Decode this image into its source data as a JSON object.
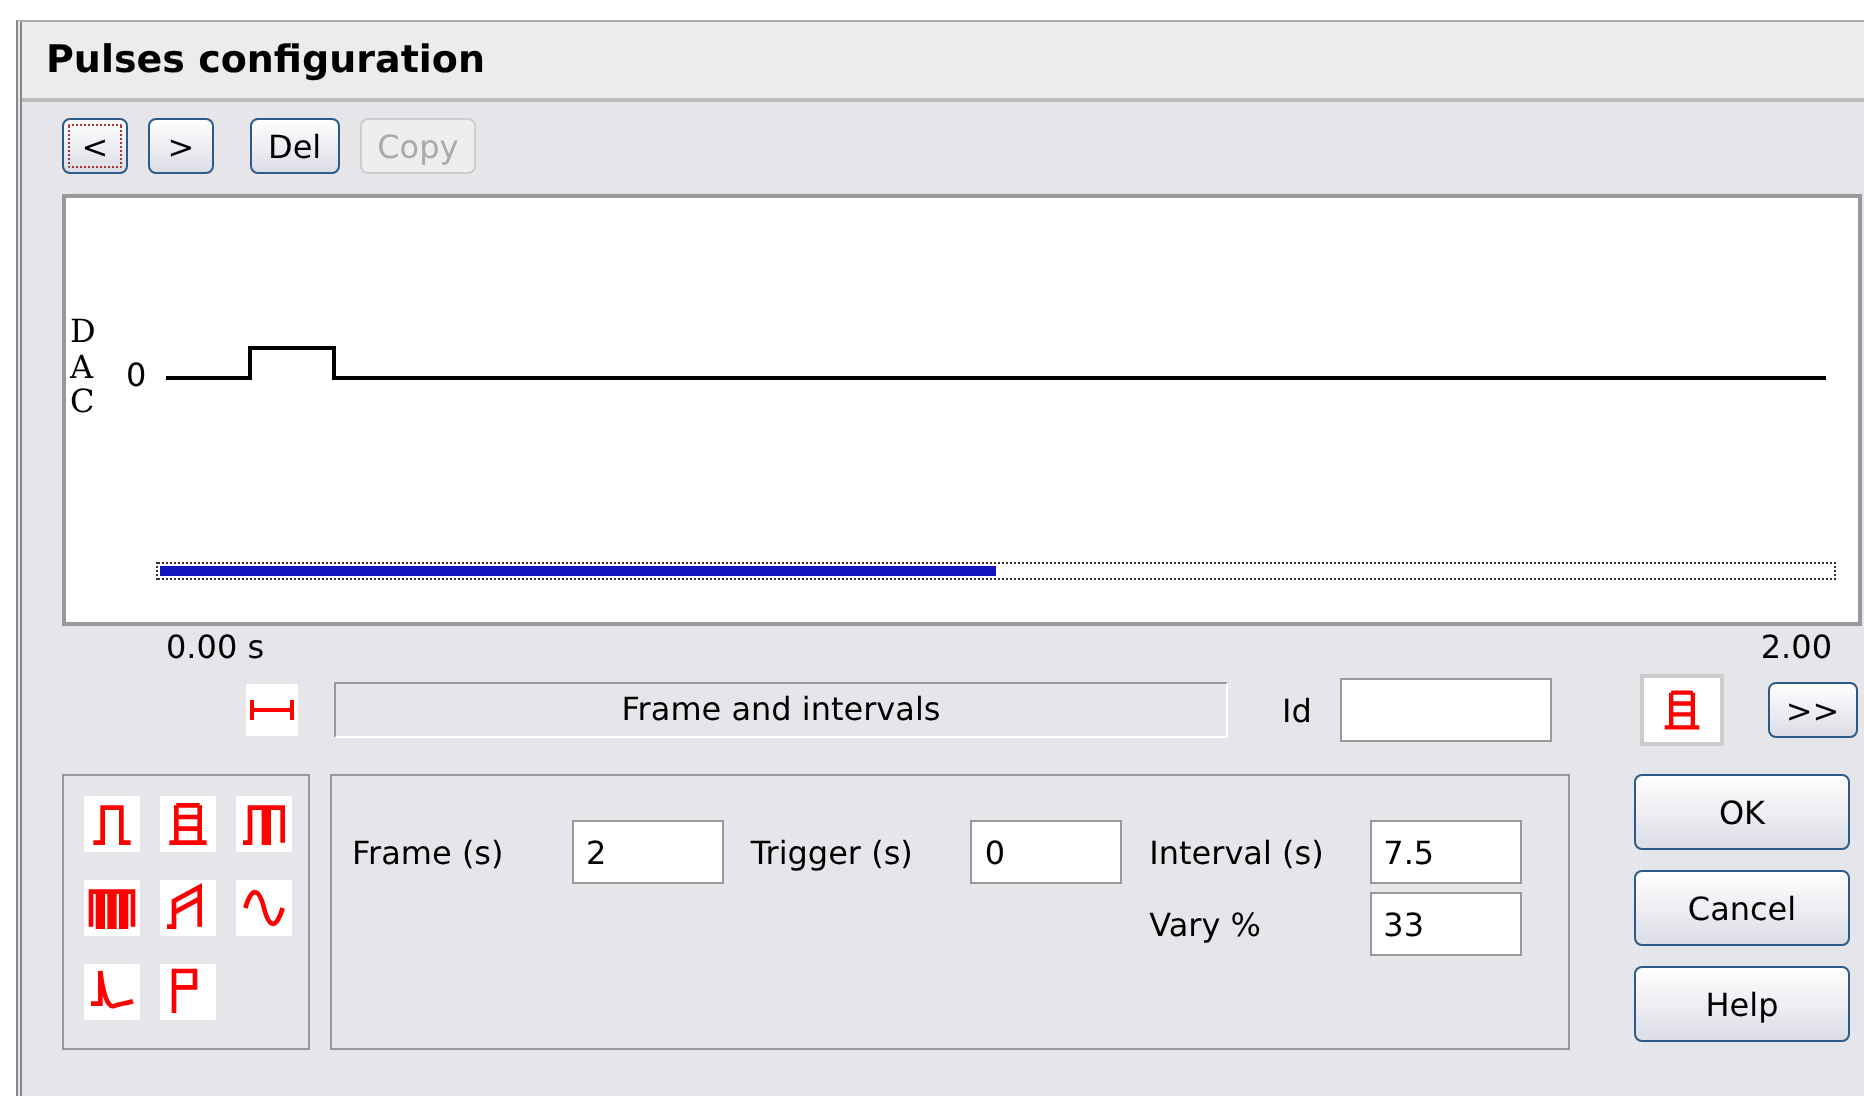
{
  "window": {
    "title": "Pulses configuration"
  },
  "toolbar": [
    {
      "label": "<",
      "disabled": false,
      "focused": true
    },
    {
      "label": ">",
      "disabled": false,
      "focused": false
    },
    {
      "label": "Del",
      "disabled": false,
      "focused": false
    },
    {
      "label": "Copy",
      "disabled": true,
      "focused": false
    }
  ],
  "plot": {
    "axis_label": "DAC",
    "zero_label": "0",
    "time_start": "0.00 s",
    "time_end": "2.00",
    "position": {
      "level": 0.5
    }
  },
  "section": {
    "title": "Frame and intervals",
    "id_label": "Id",
    "next_button": ">>"
  },
  "params": [
    {
      "label": "Frame (s)",
      "value": "2"
    },
    {
      "label": "Trigger (s)",
      "value": "0"
    },
    {
      "label": "Interval (s)",
      "value": "7.5"
    },
    {
      "label": "Vary %",
      "value": "33"
    }
  ],
  "buttons": [
    "OK",
    "Cancel",
    "Help"
  ]
}
